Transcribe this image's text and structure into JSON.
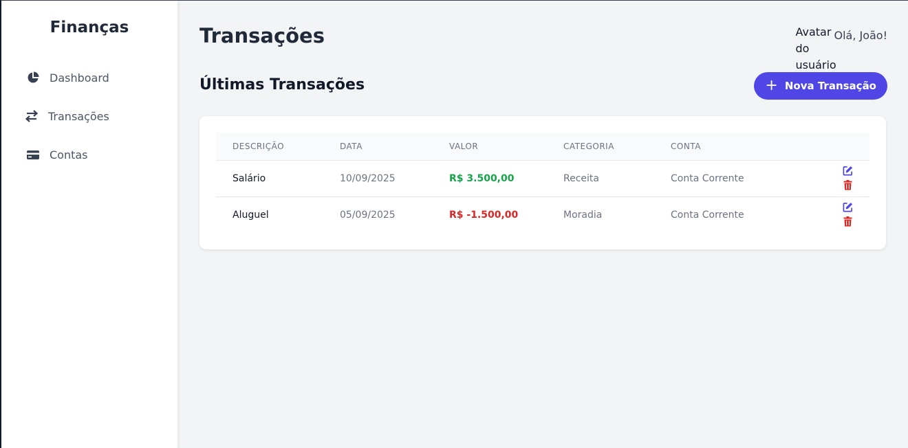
{
  "sidebar": {
    "brand": "Finanças",
    "items": [
      {
        "label": "Dashboard",
        "icon": "pie-chart-icon"
      },
      {
        "label": "Transações",
        "icon": "exchange-icon"
      },
      {
        "label": "Contas",
        "icon": "credit-card-icon"
      }
    ]
  },
  "header": {
    "title": "Transações",
    "avatar_alt": "Avatar do usuário",
    "greeting": "Olá, João!"
  },
  "section": {
    "title": "Últimas Transações",
    "new_button_label": "Nova Transação",
    "new_button_icon": "plus-icon"
  },
  "table": {
    "columns": [
      "DESCRIÇÃO",
      "DATA",
      "VALOR",
      "CATEGORIA",
      "CONTA"
    ],
    "rows": [
      {
        "description": "Salário",
        "date": "10/09/2025",
        "value": "R$ 3.500,00",
        "category": "Receita",
        "account": "Conta Corrente"
      },
      {
        "description": "Aluguel",
        "date": "05/09/2025",
        "value": "R$ -1.500,00",
        "category": "Moradia",
        "account": "Conta Corrente"
      }
    ]
  },
  "colors": {
    "accent": "#4f46e5",
    "positive": "#16a34a",
    "negative": "#dc2626"
  }
}
